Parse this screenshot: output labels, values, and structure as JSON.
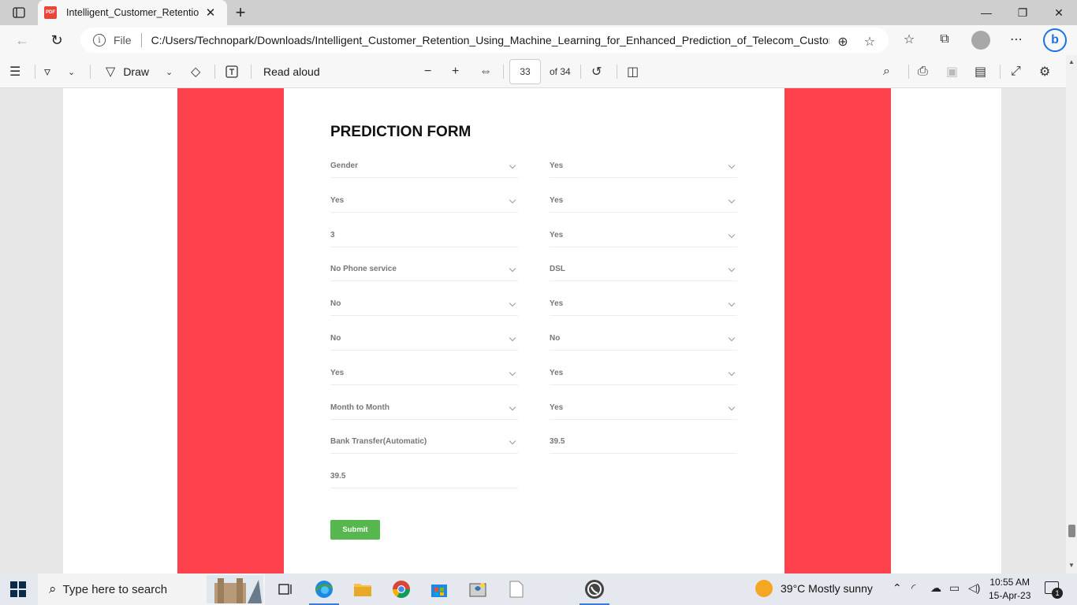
{
  "browser": {
    "tab_title": "Intelligent_Customer_Retention_U",
    "pdf_badge": "PDF",
    "file_label": "File",
    "url": "C:/Users/Technopark/Downloads/Intelligent_Customer_Retention_Using_Machine_Learning_for_Enhanced_Prediction_of_Telecom_Custom..."
  },
  "pdf_toolbar": {
    "draw_label": "Draw",
    "read_aloud_label": "Read aloud",
    "current_page": "33",
    "of_pages": "of 34"
  },
  "form": {
    "title": "PREDICTION FORM",
    "left": [
      {
        "value": "Gender",
        "dropdown": true
      },
      {
        "value": "Yes",
        "dropdown": true
      },
      {
        "value": "3",
        "dropdown": false
      },
      {
        "value": "No Phone service",
        "dropdown": true
      },
      {
        "value": "No",
        "dropdown": true
      },
      {
        "value": "No",
        "dropdown": true
      },
      {
        "value": "Yes",
        "dropdown": true
      },
      {
        "value": "Month to Month",
        "dropdown": true
      },
      {
        "value": "Bank Transfer(Automatic)",
        "dropdown": true
      },
      {
        "value": "39.5",
        "dropdown": false
      }
    ],
    "right": [
      {
        "value": "Yes",
        "dropdown": true
      },
      {
        "value": "Yes",
        "dropdown": true
      },
      {
        "value": "Yes",
        "dropdown": true
      },
      {
        "value": "DSL",
        "dropdown": true
      },
      {
        "value": "Yes",
        "dropdown": true
      },
      {
        "value": "No",
        "dropdown": true
      },
      {
        "value": "Yes",
        "dropdown": true
      },
      {
        "value": "Yes",
        "dropdown": true
      },
      {
        "value": "39.5",
        "dropdown": false
      }
    ],
    "submit_label": "Submit"
  },
  "colors": {
    "accent_red": "#fd414d",
    "submit_green": "#55b74d"
  },
  "taskbar": {
    "search_placeholder": "Type here to search",
    "weather": "39°C  Mostly sunny",
    "time": "10:55 AM",
    "date": "15-Apr-23",
    "notification_count": "1"
  }
}
